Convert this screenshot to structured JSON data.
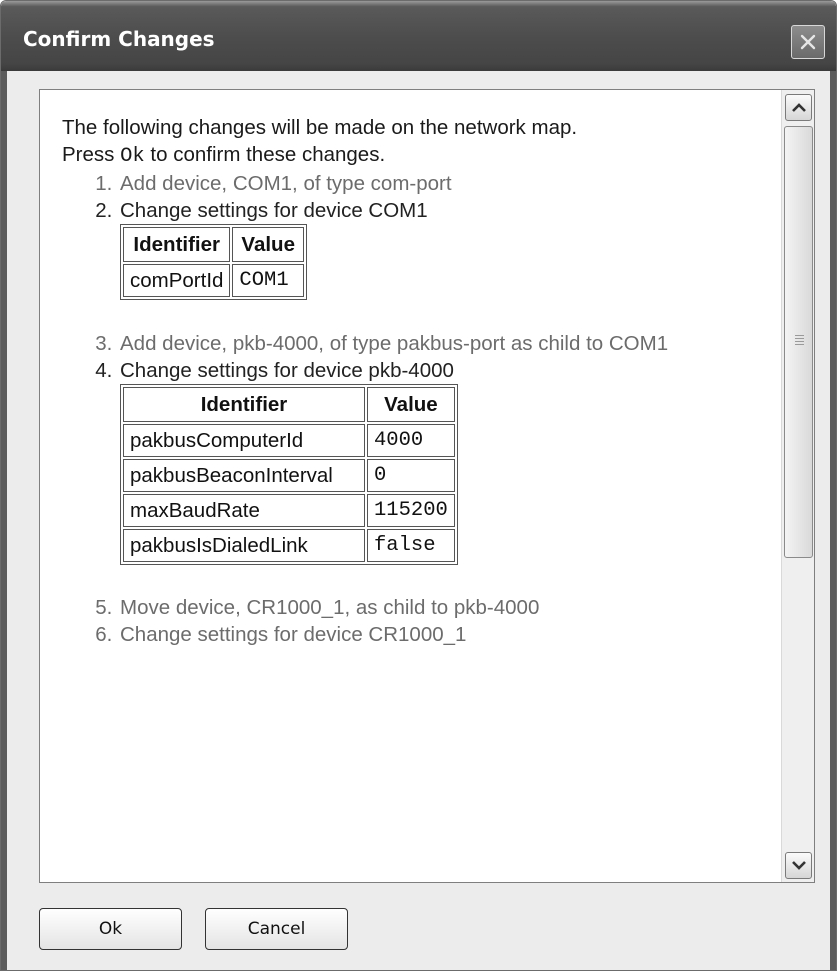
{
  "window": {
    "title": "Confirm Changes"
  },
  "intro": {
    "line1": "The following changes will be made on the network map.",
    "line2_prefix": "Press ",
    "line2_code": "Ok",
    "line2_suffix": " to confirm these changes."
  },
  "changes": [
    {
      "text": "Add device, COM1, of type com-port"
    },
    {
      "text": "Change settings for device COM1",
      "table": {
        "headers": [
          "Identifier",
          "Value"
        ],
        "rows": [
          {
            "identifier": "comPortId",
            "value": "COM1"
          }
        ]
      }
    },
    {
      "text": "Add device, pkb-4000, of type pakbus-port as child to COM1"
    },
    {
      "text": "Change settings for device pkb-4000",
      "table": {
        "headers": [
          "Identifier",
          "Value"
        ],
        "rows": [
          {
            "identifier": "pakbusComputerId",
            "value": "4000"
          },
          {
            "identifier": "pakbusBeaconInterval",
            "value": "0"
          },
          {
            "identifier": "maxBaudRate",
            "value": "115200"
          },
          {
            "identifier": "pakbusIsDialedLink",
            "value": "false"
          }
        ]
      }
    },
    {
      "text": "Move device, CR1000_1, as child to pkb-4000"
    },
    {
      "text": "Change settings for device CR1000_1"
    }
  ],
  "buttons": {
    "ok": "Ok",
    "cancel": "Cancel"
  },
  "icons": {
    "close": "close-icon",
    "scroll_up": "scroll-up-arrow-icon",
    "scroll_down": "scroll-down-arrow-icon"
  }
}
